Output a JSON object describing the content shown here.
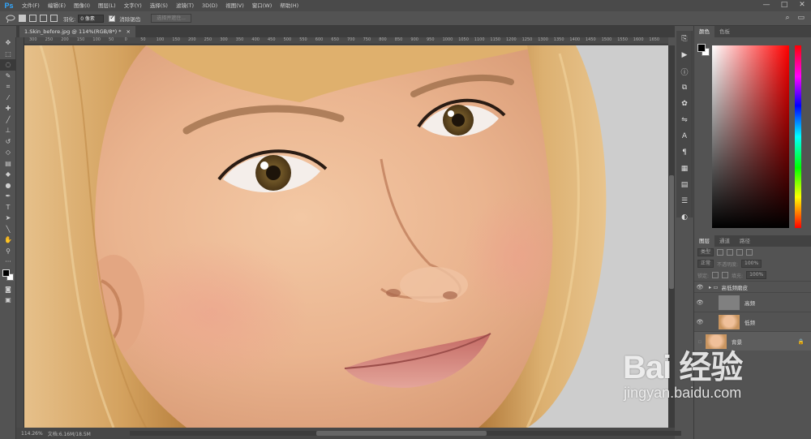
{
  "app": {
    "logo": "Ps"
  },
  "menu": [
    "文件(F)",
    "编辑(E)",
    "图像(I)",
    "图层(L)",
    "文字(Y)",
    "选择(S)",
    "滤镜(T)",
    "3D(D)",
    "视图(V)",
    "窗口(W)",
    "帮助(H)"
  ],
  "window_controls": [
    "—",
    "□",
    "✕"
  ],
  "options": {
    "feather_label": "羽化:",
    "feather_value": "0 像素",
    "antialias_label": "消除锯齿",
    "select_mask_button": "选择并遮住..."
  },
  "document": {
    "tab_title": "1.Skin_before.jpg @ 114%(RGB/8*) *",
    "close": "×"
  },
  "ruler_ticks": [
    "300",
    "250",
    "200",
    "150",
    "100",
    "50",
    "0",
    "50",
    "100",
    "150",
    "200",
    "250",
    "300",
    "350",
    "400",
    "450",
    "500",
    "550",
    "600",
    "650",
    "700",
    "750",
    "800",
    "850",
    "900",
    "950",
    "1000",
    "1050",
    "1100",
    "1150",
    "1200",
    "1250",
    "1300",
    "1350",
    "1400",
    "1450",
    "1500",
    "1550",
    "1600",
    "1650"
  ],
  "status": {
    "zoom": "114.26%",
    "doc_size": "文档:6.16M/18.5M"
  },
  "color_panel": {
    "tabs": [
      "颜色",
      "色板"
    ],
    "foreground": "#000000",
    "background": "#ffffff"
  },
  "layers_panel": {
    "tabs": [
      "图层",
      "通道",
      "路径"
    ],
    "filter_kind": "类型",
    "blend_mode": "正常",
    "opacity_label": "不透明度:",
    "opacity_value": "100%",
    "lock_label": "锁定:",
    "fill_label": "填充:",
    "fill_value": "100%",
    "layers": [
      {
        "name": "高低频磨皮",
        "type": "group"
      },
      {
        "name": "高频",
        "type": "layer"
      },
      {
        "name": "低频",
        "type": "layer"
      },
      {
        "name": "背景",
        "type": "background"
      }
    ]
  },
  "watermark": {
    "logo": "Bai 经验",
    "url": "jingyan.baidu.com"
  }
}
